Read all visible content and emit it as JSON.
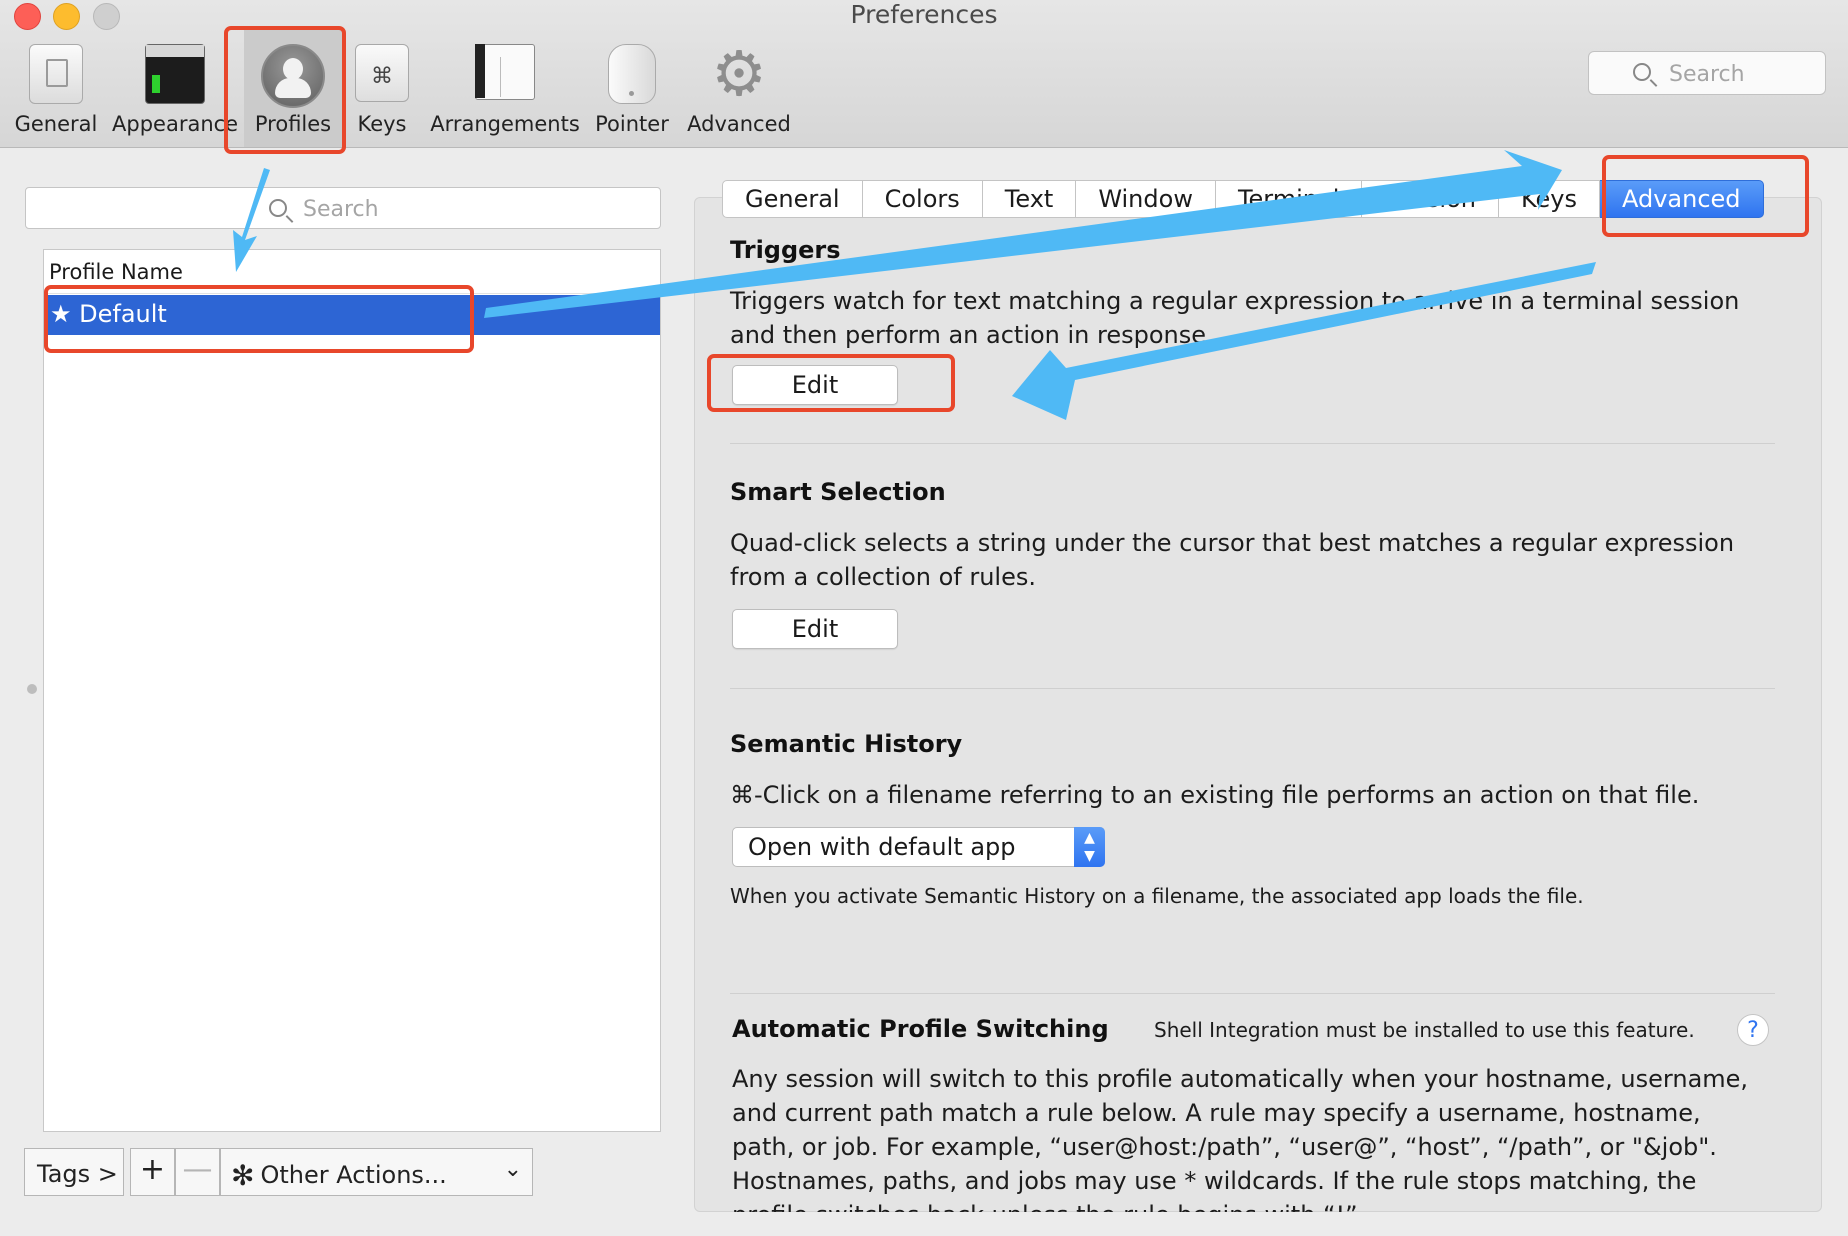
{
  "window": {
    "title": "Preferences"
  },
  "toolbar": {
    "items": [
      {
        "label": "General",
        "icon": "general-icon"
      },
      {
        "label": "Appearance",
        "icon": "appearance-icon"
      },
      {
        "label": "Profiles",
        "icon": "profiles-icon",
        "selected": true
      },
      {
        "label": "Keys",
        "icon": "keys-icon"
      },
      {
        "label": "Arrangements",
        "icon": "arrangements-icon"
      },
      {
        "label": "Pointer",
        "icon": "pointer-icon"
      },
      {
        "label": "Advanced",
        "icon": "advanced-icon"
      }
    ],
    "keys_glyph": "⌘",
    "search_placeholder": "Search"
  },
  "profiles": {
    "search_placeholder": "Search",
    "column_header": "Profile Name",
    "rows": [
      {
        "name": "★ Default",
        "selected": true
      }
    ]
  },
  "bottom_bar": {
    "tags_label": "Tags >",
    "add_label": "+",
    "remove_label": "—",
    "actions_label": "Other Actions...",
    "actions_gear": "✻",
    "actions_chevron": "⌄"
  },
  "tabs": [
    {
      "label": "General"
    },
    {
      "label": "Colors"
    },
    {
      "label": "Text"
    },
    {
      "label": "Window"
    },
    {
      "label": "Terminal"
    },
    {
      "label": "Session"
    },
    {
      "label": "Keys"
    },
    {
      "label": "Advanced",
      "active": true
    }
  ],
  "advanced": {
    "triggers": {
      "title": "Triggers",
      "line1": "Triggers watch for text matching a regular expression to arrive in a terminal session",
      "line2": "and then perform an action in response.",
      "button": "Edit"
    },
    "smart_selection": {
      "title": "Smart Selection",
      "line1": "Quad-click selects a string under the cursor that best matches a regular expression",
      "line2": "from a collection of rules.",
      "button": "Edit"
    },
    "semantic_history": {
      "title": "Semantic History",
      "description": "⌘-Click on a filename referring to an existing file performs an action on that file.",
      "popup_value": "Open with default app",
      "note": "When you activate Semantic History on a filename, the associated app loads the file."
    },
    "auto_profile_switching": {
      "title": "Automatic Profile Switching",
      "hint": "Shell Integration must be installed to use this feature.",
      "help_label": "?",
      "lines": [
        "Any session will switch to this profile automatically when your hostname, username,",
        "and current path match a rule below. A rule may specify a username, hostname,",
        "path, or job. For example, “user@host:/path”, “user@”, “host”, “/path”, or \"&job\".",
        "Hostnames, paths, and jobs may use * wildcards. If the rule stops matching, the",
        "profile switches back unless the rule begins with “!”."
      ]
    }
  },
  "annotation_colors": {
    "highlight": "#e8472b",
    "arrow": "#4fb9f5"
  }
}
